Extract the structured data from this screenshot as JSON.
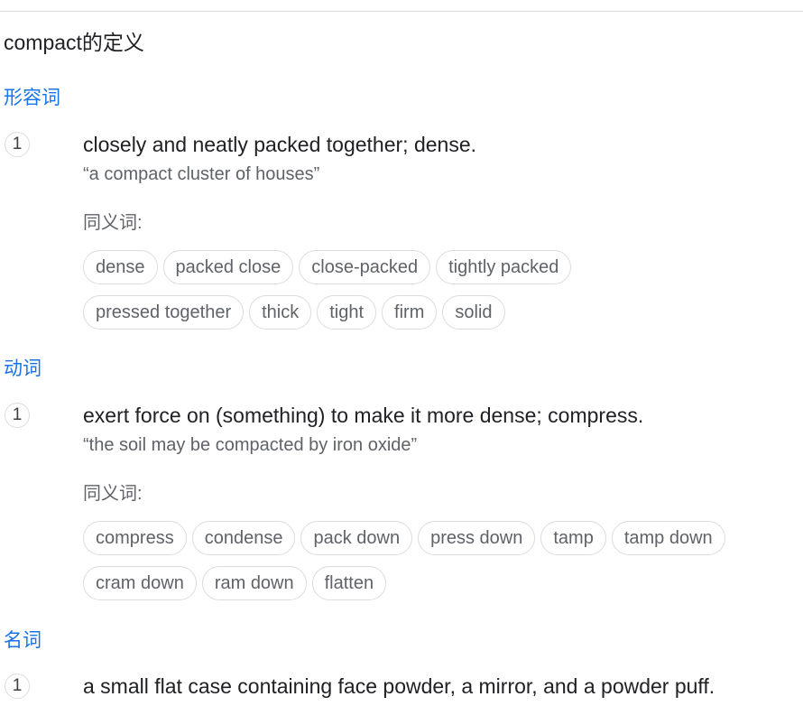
{
  "title": "compact的定义",
  "sections": [
    {
      "pos": "形容词",
      "number": "1",
      "definition": "closely and neatly packed together; dense.",
      "example": "“a compact cluster of houses”",
      "synonyms_label": "同义词:",
      "synonyms": [
        [
          "dense",
          "packed close",
          "close-packed",
          "tightly packed"
        ],
        [
          "pressed together",
          "thick",
          "tight",
          "firm",
          "solid"
        ]
      ]
    },
    {
      "pos": "动词",
      "number": "1",
      "definition": "exert force on (something) to make it more dense; compress.",
      "example": "“the soil may be compacted by iron oxide”",
      "synonyms_label": "同义词:",
      "synonyms": [
        [
          "compress",
          "condense",
          "pack down",
          "press down",
          "tamp",
          "tamp down"
        ],
        [
          "cram down",
          "ram down",
          "flatten"
        ]
      ]
    },
    {
      "pos": "名词",
      "number": "1",
      "definition": "a small flat case containing face powder, a mirror, and a powder puff."
    }
  ],
  "colors": {
    "pos_heading": "#1a73e8",
    "text": "#202124",
    "secondary_text": "#5f6368",
    "border": "#dadce0"
  }
}
